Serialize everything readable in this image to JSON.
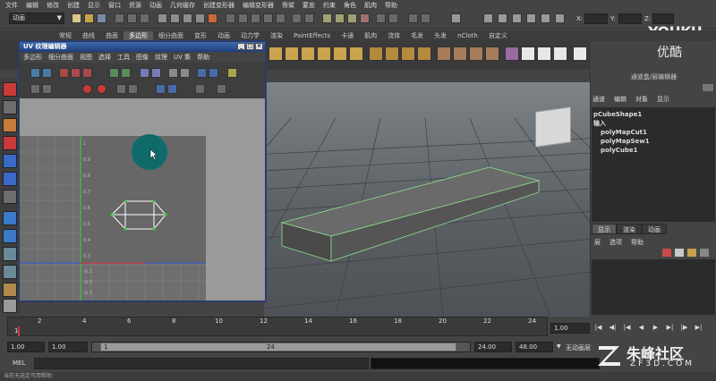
{
  "menubar": [
    "文件",
    "编辑",
    "修改",
    "创建",
    "显示",
    "窗口",
    "资源",
    "动画",
    "几何缓存",
    "创建变形器",
    "编辑变形器",
    "骨架",
    "蒙皮",
    "约束",
    "角色",
    "肌肉",
    "帮助"
  ],
  "status": {
    "mode": "动画",
    "x_label": "X:",
    "y_label": "Y:",
    "z_label": "Z:"
  },
  "shelf_tabs": {
    "items": [
      "常规",
      "曲线",
      "曲面",
      "多边形",
      "细分曲面",
      "变形",
      "动画",
      "动力学",
      "渲染",
      "PaintEffects",
      "卡通",
      "肌肉",
      "流体",
      "毛发",
      "头发",
      "nCloth",
      "自定义"
    ],
    "active_index": 3
  },
  "uv_editor": {
    "title": "UV 纹理编辑器",
    "menu": [
      "多边形",
      "细分曲面",
      "视图",
      "选择",
      "工具",
      "图像",
      "纹理",
      "UV 集",
      "帮助"
    ],
    "ticks_v": [
      "1",
      "0.9",
      "0.8",
      "0.7",
      "0.6",
      "0.5",
      "0.4",
      "0.3",
      "0.2",
      "0.1"
    ],
    "ticks_v_neg": [
      "-0.1",
      "-0.2",
      "-0.3"
    ]
  },
  "right_panel": {
    "title": "通道盒/层编辑器",
    "tabs": [
      "通道",
      "编辑",
      "对象",
      "显示"
    ],
    "shape": "pCubeShape1",
    "inputs_label": "输入",
    "inputs": [
      "polyMapCut1",
      "polyMapSew1",
      "polyCube1"
    ],
    "layer_tabs": [
      "显示",
      "渲染",
      "动画"
    ],
    "layer_tab_active": 0,
    "layer_menu": [
      "层",
      "选项",
      "帮助"
    ]
  },
  "watermark": {
    "brand": "YOUKU",
    "brand_cn": "优酷",
    "site_cn": "朱峰社区",
    "site": "ZF3D.COM"
  },
  "timeline": {
    "ticks": [
      "1",
      "2",
      "4",
      "6",
      "8",
      "10",
      "12",
      "14",
      "16",
      "18",
      "20",
      "22",
      "24"
    ],
    "current_frame": "1.00"
  },
  "range": {
    "start": "1.00",
    "playback_start": "1.00",
    "handle_start": "1",
    "handle_end": "24",
    "playback_end": "24.00",
    "end": "48.00",
    "anim_layer": "无动画层"
  },
  "cmdline": {
    "label": "MEL"
  },
  "helpline": "当前无选定可用帮助"
}
